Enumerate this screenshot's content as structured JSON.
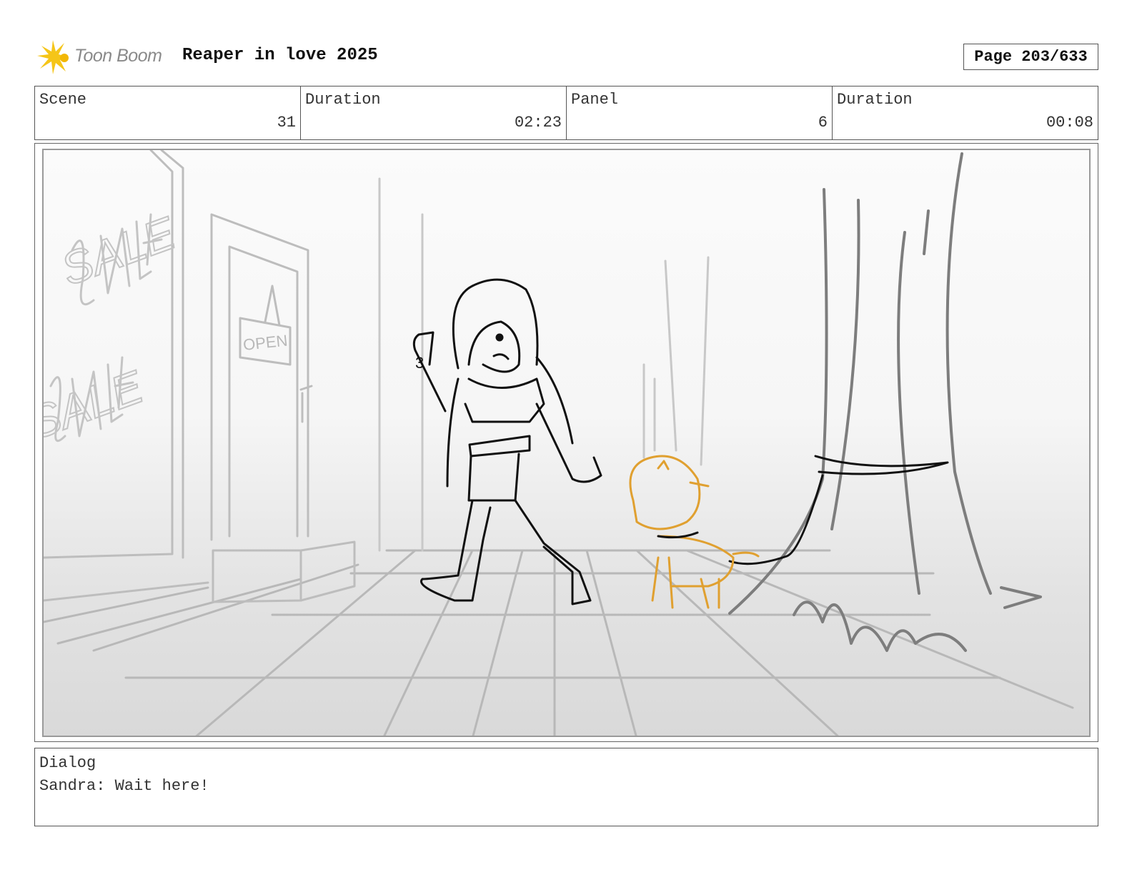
{
  "header": {
    "logo_text": "Toon Boom",
    "title": "Reaper in love 2025",
    "page": "Page 203/633"
  },
  "info": [
    {
      "label": "Scene",
      "value": "31"
    },
    {
      "label": "Duration",
      "value": "02:23"
    },
    {
      "label": "Panel",
      "value": "6"
    },
    {
      "label": "Duration",
      "value": "00:08"
    }
  ],
  "sketch": {
    "window_text_1": "SALE",
    "window_text_2": "SALE",
    "door_sign": "OPEN",
    "girl_hand_number": "3"
  },
  "dialog": {
    "label": "Dialog",
    "lines": [
      "Sandra: Wait here!"
    ]
  },
  "colors": {
    "logo_yellow": "#f5c518",
    "dog_orange": "#e0a030",
    "sketch_gray": "#b8b8b8",
    "ink": "#111111"
  }
}
